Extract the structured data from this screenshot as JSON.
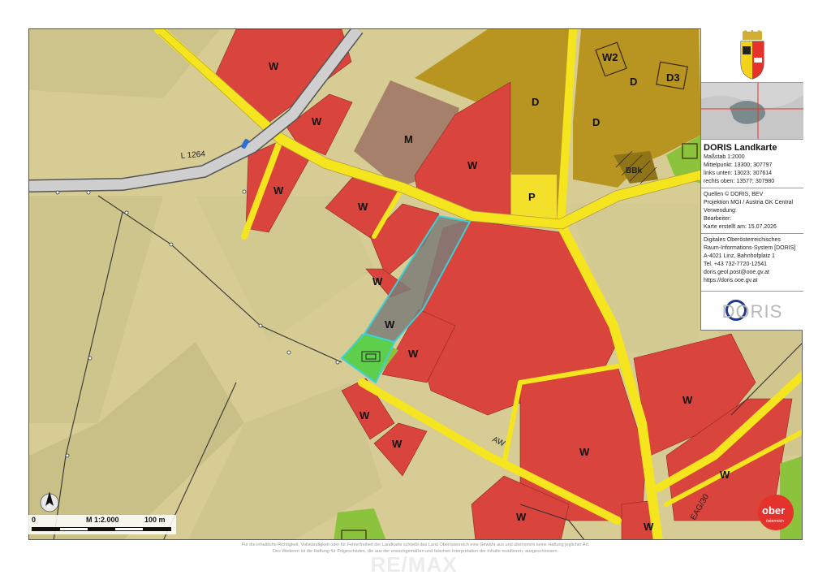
{
  "map": {
    "zones": {
      "w": "W",
      "d": "D",
      "m": "M",
      "p": "P",
      "w2": "W2",
      "d3": "D3",
      "bbk": "BBk",
      "aw": "AW"
    },
    "road_label": "L 1264",
    "road_label_eag": "EAG/30",
    "road_shield": "0",
    "colors": {
      "residential": "#d9443c",
      "village": "#b89420",
      "mixed": "#a6806a",
      "parking": "#f2e02a",
      "green": "#8bc33c",
      "road": "#f5e51f",
      "agriculture": "#d6cc94",
      "selection": "#3cd1d8"
    }
  },
  "north_arrow": {
    "label": "N"
  },
  "scalebar": {
    "start": "0",
    "scale": "M 1:2.000",
    "end": "100 m"
  },
  "panel": {
    "title": "DORIS Landkarte",
    "scale": "Maßstab 1:2000",
    "center": "Mittelpunkt: 13300; 307797",
    "lower_left": "links unten: 13023; 307614",
    "upper_right": "rechts oben: 13577; 307980",
    "sources": "Quellen © DORIS, BEV",
    "projection": "Projektion MGI / Austria GK Central",
    "usage": "Verwendung:",
    "editor": "Bearbeiter:",
    "created": "Karte erstellt am: 15.07.2026",
    "org1": "Digitales Oberösterreichisches",
    "org2": "Raum-Informations-System [DORIS]",
    "address": "A-4021 Linz, Bahnhofplatz 1",
    "phone": "Tel. +43 732-7720-12541",
    "email": "doris.geol.post@ooe.gv.at",
    "web": "https://doris.ooe.gv.at",
    "logo": "DORIS"
  },
  "ober_logo": {
    "line1": "ober",
    "line2": "österreich"
  },
  "disclaimer": {
    "line1": "Für die inhaltliche Richtigkeit, Vollständigkeit oder für Fehlerfreiheit der Landkarte schließt das Land Oberösterreich eine Gewähr aus und übernimmt keine Haftung jeglicher Art.",
    "line2": "Des Weiteren ist die Haftung für Folgeschäden, die aus der unsachgemäßen und falschen Interpretation der Inhalte resultieren, ausgeschlossen."
  },
  "watermark": "RE/MAX"
}
